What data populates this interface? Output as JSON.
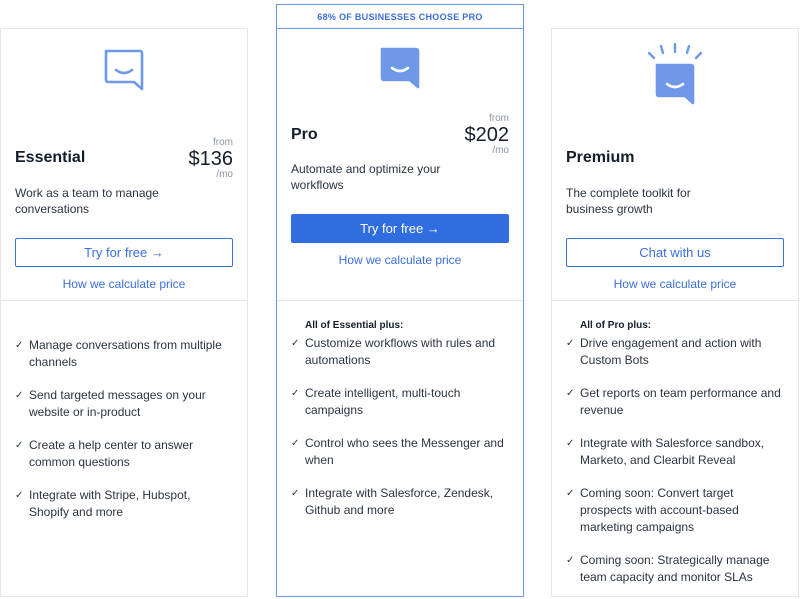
{
  "plans": [
    {
      "name": "Essential",
      "price_prefix": "from",
      "price": "$136",
      "price_suffix": "/mo",
      "tagline": "Work as a team to manage conversations",
      "cta": "Try for free →",
      "calc_link": "How we calculate price",
      "features_heading": "",
      "features": [
        "Manage conversations from multiple channels",
        "Send targeted messages on your website or in-product",
        "Create a help center to answer common questions",
        "Integrate with Stripe, Hubspot, Shopify and more"
      ]
    },
    {
      "banner": "68% OF BUSINESSES CHOOSE PRO",
      "name": "Pro",
      "price_prefix": "from",
      "price": "$202",
      "price_suffix": "/mo",
      "tagline": "Automate and optimize your workflows",
      "cta": "Try for free →",
      "calc_link": "How we calculate price",
      "features_heading": "All of Essential plus:",
      "features": [
        "Customize workflows with rules and automations",
        "Create intelligent, multi-touch campaigns",
        "Control who sees the Messenger and when",
        "Integrate with Salesforce, Zendesk, Github and more"
      ]
    },
    {
      "name": "Premium",
      "tagline": "The complete toolkit for business growth",
      "cta": "Chat with us",
      "calc_link": "How we calculate price",
      "features_heading": "All of Pro plus:",
      "features": [
        "Drive engagement and action with Custom Bots",
        "Get reports on team performance and revenue",
        "Integrate with Salesforce sandbox, Marketo, and Clearbit Reveal",
        "Coming soon: Convert target prospects with account-based marketing campaigns",
        "Coming soon: Strategically manage team capacity and monitor SLAs"
      ]
    }
  ],
  "icons": {
    "essential": "chat-bubble-outline-icon",
    "pro": "chat-bubble-filled-icon",
    "premium": "chat-bubble-glowing-icon",
    "check": "check-icon"
  },
  "colors": {
    "accent": "#2f6de0",
    "icon": "#6f99e8",
    "border": "#e3e7ec"
  }
}
